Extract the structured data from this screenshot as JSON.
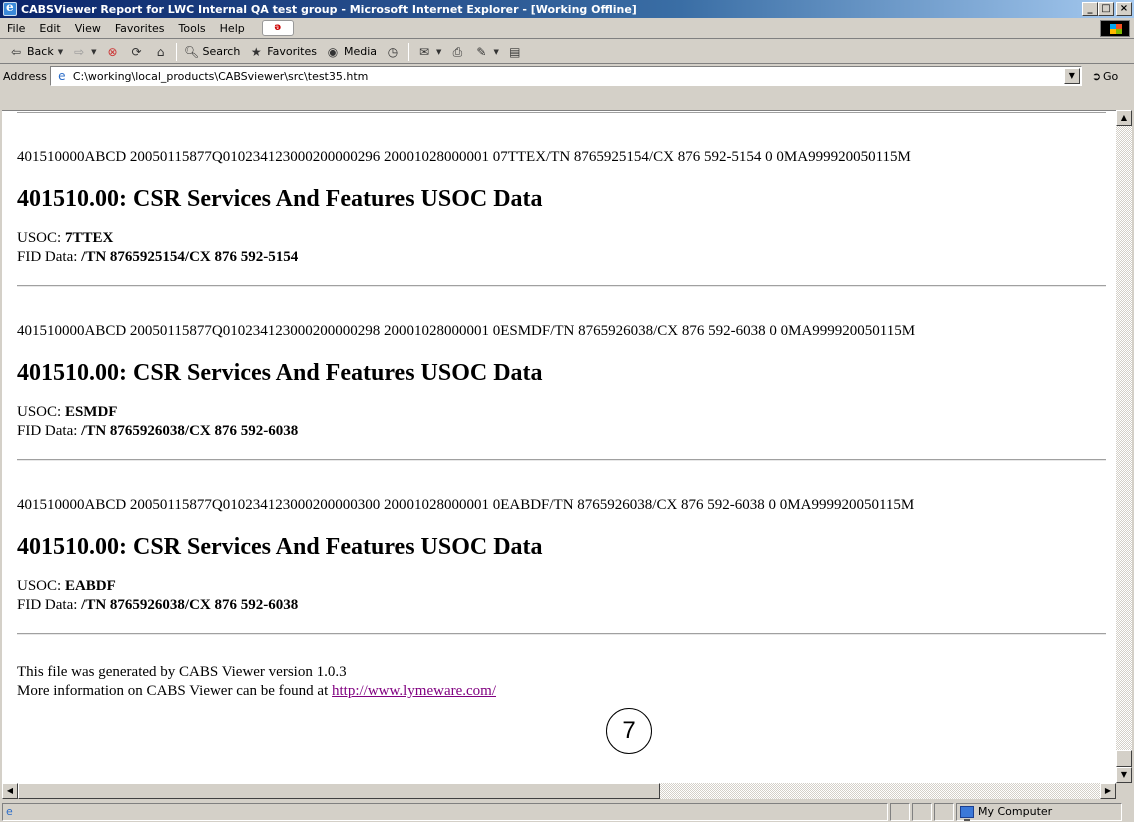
{
  "window": {
    "title": "CABSViewer Report for LWC Internal QA test group - Microsoft Internet Explorer - [Working Offline]",
    "buttons": {
      "minimize": "_",
      "maximize": "□",
      "close": "×"
    }
  },
  "menu": {
    "items": [
      "File",
      "Edit",
      "View",
      "Favorites",
      "Tools",
      "Help"
    ]
  },
  "toolbar": {
    "back_label": "Back",
    "search_label": "Search",
    "favorites_label": "Favorites",
    "media_label": "Media"
  },
  "address": {
    "label": "Address",
    "url": "C:\\working\\local_products\\CABSviewer\\src\\test35.htm",
    "go_label": "Go"
  },
  "content": {
    "records": [
      {
        "raw": "401510000ABCD 20050115877Q010234123000200000296 20001028000001 07TTEX/TN 8765925154/CX 876 592-5154 0 0MA999920050115M",
        "heading": "401510.00: CSR Services And Features USOC Data",
        "usoc_label": "USOC:",
        "usoc_value": "7TTEX",
        "fid_label": "FID Data:",
        "fid_value": "/TN 8765925154/CX 876 592-5154"
      },
      {
        "raw": "401510000ABCD 20050115877Q010234123000200000298 20001028000001 0ESMDF/TN 8765926038/CX 876 592-6038 0 0MA999920050115M",
        "heading": "401510.00: CSR Services And Features USOC Data",
        "usoc_label": "USOC:",
        "usoc_value": "ESMDF",
        "fid_label": "FID Data:",
        "fid_value": "/TN 8765926038/CX 876 592-6038"
      },
      {
        "raw": "401510000ABCD 20050115877Q010234123000200000300 20001028000001 0EABDF/TN 8765926038/CX 876 592-6038 0 0MA999920050115M",
        "heading": "401510.00: CSR Services And Features USOC Data",
        "usoc_label": "USOC:",
        "usoc_value": "EABDF",
        "fid_label": "FID Data:",
        "fid_value": "/TN 8765926038/CX 876 592-6038"
      }
    ],
    "footer": {
      "line1": "This file was generated by CABS Viewer version 1.0.3",
      "line2_prefix": "More information on CABS Viewer can be found at ",
      "link_text": "http://www.lymeware.com/"
    },
    "callout_number": "7"
  },
  "statusbar": {
    "zone_label": "My Computer"
  }
}
